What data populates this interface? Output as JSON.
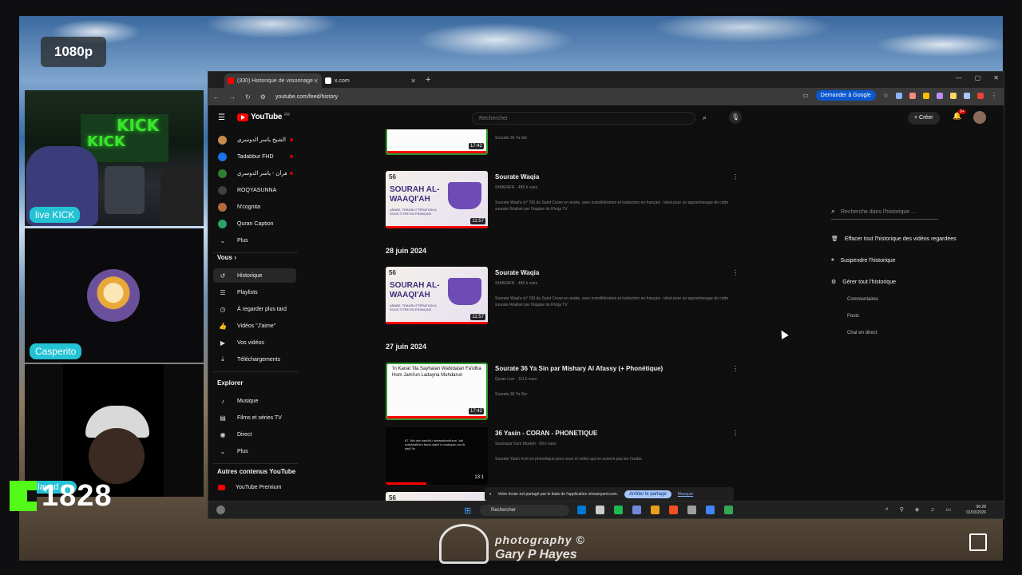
{
  "overlay": {
    "quality_badge": "1080p",
    "cam1_name": "live KICK",
    "cam2_name": "Casperito",
    "cam3_name": "Ilayad",
    "kick_count": "1828",
    "photo_credit_line1": "photography ©",
    "photo_credit_line2": "Gary P Hayes"
  },
  "browser": {
    "tabs": [
      {
        "label": "(330) Historique de visionnage",
        "favicon_color": "#ff0000",
        "active": true
      },
      {
        "label": "x.com",
        "favicon_color": "#ffffff",
        "active": false
      }
    ],
    "url": "youtube.com/feed/history",
    "ask_google": "Demander à Google",
    "extension_colors": [
      "#8ab4f8",
      "#f28b82",
      "#fbbc04",
      "#c58af9",
      "#fdd663",
      "#a8c7fa",
      "#ea4335"
    ]
  },
  "youtube": {
    "logo": "YouTube",
    "logo_country": "FR",
    "search_placeholder": "Rechercher",
    "create_label": "Créer",
    "notifications": "9+",
    "sidebar": {
      "subscriptions": [
        {
          "label": "الشيخ ياسر الدوسري -",
          "color": "#c88a4a",
          "live": true
        },
        {
          "label": "Tadabbur FHD",
          "color": "#1a73e8",
          "live": true
        },
        {
          "label": "القرآن - ياسر الدوسري",
          "color": "#2e7d32",
          "live": true
        },
        {
          "label": "ROQYASUNNA",
          "color": "#3f3f3f",
          "live": false
        },
        {
          "label": "N'cognita",
          "color": "#b56a3e",
          "live": false
        },
        {
          "label": "Quran Caption",
          "color": "#2ba36a",
          "live": false
        }
      ],
      "more_label": "Plus",
      "you_heading": "Vous",
      "you_items": [
        {
          "label": "Historique",
          "icon": "history-icon",
          "glyph": "↺",
          "active": true
        },
        {
          "label": "Playlists",
          "icon": "playlist-icon",
          "glyph": "☰",
          "active": false
        },
        {
          "label": "À regarder plus tard",
          "icon": "clock-icon",
          "glyph": "◷",
          "active": false
        },
        {
          "label": "Vidéos \"J'aime\"",
          "icon": "thumbs-up-icon",
          "glyph": "👍",
          "active": false
        },
        {
          "label": "Vos vidéos",
          "icon": "your-videos-icon",
          "glyph": "▶",
          "active": false
        },
        {
          "label": "Téléchargements",
          "icon": "download-icon",
          "glyph": "⤓",
          "active": false
        }
      ],
      "explore_heading": "Explorer",
      "explore_items": [
        {
          "label": "Musique",
          "icon": "music-icon",
          "glyph": "♪"
        },
        {
          "label": "Films et séries TV",
          "icon": "film-icon",
          "glyph": "▤"
        },
        {
          "label": "Direct",
          "icon": "live-icon",
          "glyph": "◉"
        }
      ],
      "explore_more": "Plus",
      "other_heading": "Autres contenus YouTube",
      "premium": "YouTube Premium"
    },
    "feed": {
      "top_partial": {
        "meta": "Sourate 36 Ya Sin",
        "duration": "17:42"
      },
      "groups": [
        {
          "date": "",
          "videos": [
            {
              "title": "Sourate Waqia",
              "meta": "SHIAFAFR · 485 k vues",
              "desc": "Sourate Waqi'a (n° 56) du Saint Coran en arabe, avec translittération et traduction en français : idéal pour un apprentissage de cette sourate Réalisé par l'équipe de Khoja TV",
              "duration": "11:57",
              "thumb": "waq"
            }
          ]
        },
        {
          "date": "28 juin 2024",
          "videos": [
            {
              "title": "Sourate Waqia",
              "meta": "SHIAFAFR · 485 k vues",
              "desc": "Sourate Waqi'a (n° 56) du Saint Coran en arabe, avec translittération et traduction en français : idéal pour un apprentissage de cette sourate Réalisé par l'équipe de Khoja TV",
              "duration": "11:57",
              "thumb": "waq"
            }
          ]
        },
        {
          "date": "27 juin 2024",
          "videos": [
            {
              "title": "Sourate 36 Ya Sin par Mishary Al Afassy (+ Phonétique)",
              "meta": "Quran Live · 111 k vues",
              "desc": "Sourate 36 Ya Sin",
              "duration": "17:42",
              "thumb": "yas"
            },
            {
              "title": "36 Yasin - CORAN - PHONETIQUE",
              "meta": "Soumaya Oum Mosleh · 69 k vues",
              "desc": "Sourate Yasin écrit en phonétique pour ceux et celles qui ne suivent pas les l'arabe.",
              "duration": "13:1",
              "thumb": "dark"
            }
          ]
        }
      ],
      "thumb_waq_num": "56",
      "thumb_waq_title": "SOURAH AL-WAAQI'AH",
      "thumb_waq_sub": "ARABE, TRANSLITTÉRATION & SOUS-TITRE EN FRANÇAIS",
      "thumb_yas_text": "'in Kanat 'illa Sayhatan Wahidatan Fa'idha Hum Jami'un Ladayna Muhdarun",
      "thumb_dark_text": "67. Wa law nashā'u lamasakhnāhum ʿalā makānatihim famā-staṭāʿū muḍiyyan wa lā yarjiʿūn",
      "next_partial_num": "56"
    },
    "right_panel": {
      "search_placeholder": "Recherche dans l'historique ...",
      "clear_all": "Effacer tout l'historique des vidéos regardées",
      "pause": "Suspendre l'historique",
      "manage": "Gérer tout l'historique",
      "sub_items": [
        "Commentaires",
        "Posts",
        "Chat en direct"
      ]
    },
    "share_bar": {
      "text": "Votre écran est partagé par le biais de l'application streamyard.com.",
      "stop": "Arrêter le partage",
      "hide": "Masquer"
    }
  },
  "taskbar": {
    "search": "Rechercher",
    "time": "06:28",
    "date": "01/03/2026",
    "app_colors": [
      "#0078d4",
      "#cccccc",
      "#1db954",
      "#7289da",
      "#e8a01a",
      "#f25022",
      "#a0a0a0",
      "#4285f4",
      "#34a853"
    ]
  }
}
